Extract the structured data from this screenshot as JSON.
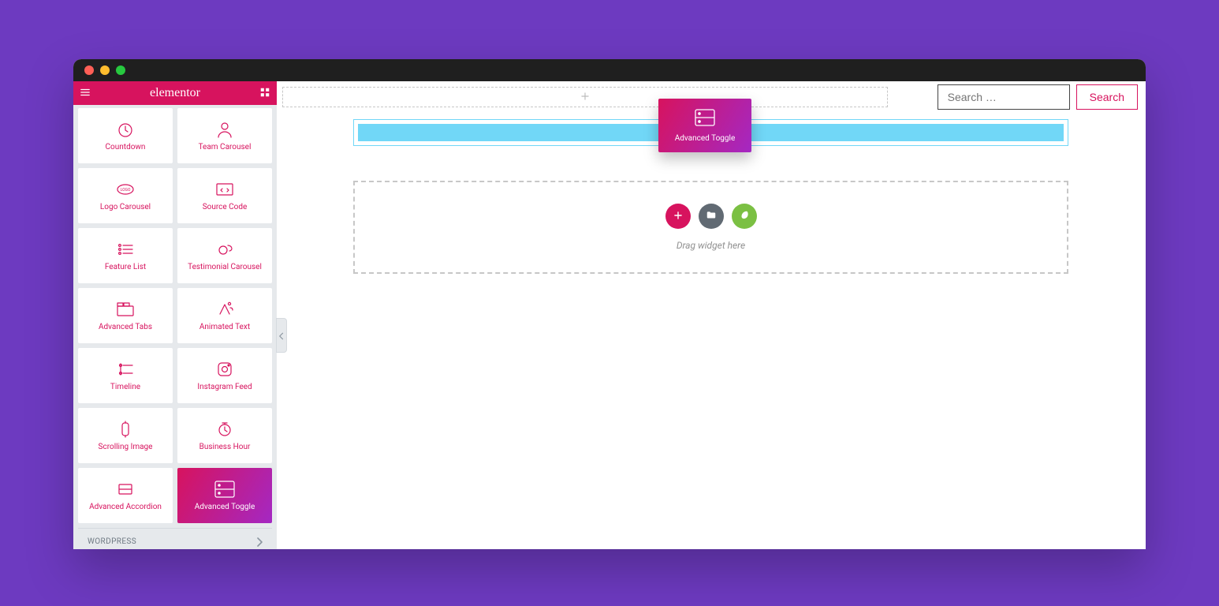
{
  "brand": "elementor",
  "category_label": "WORDPRESS",
  "search": {
    "placeholder": "Search …",
    "button": "Search"
  },
  "drag_hint": "Drag widget here",
  "drag_preview_label": "Advanced Toggle",
  "widgets": [
    {
      "label": "Countdown",
      "icon": "countdown"
    },
    {
      "label": "Team Carousel",
      "icon": "team"
    },
    {
      "label": "Logo Carousel",
      "icon": "logo"
    },
    {
      "label": "Source Code",
      "icon": "code"
    },
    {
      "label": "Feature List",
      "icon": "list"
    },
    {
      "label": "Testimonial Carousel",
      "icon": "testimonial"
    },
    {
      "label": "Advanced Tabs",
      "icon": "tabs"
    },
    {
      "label": "Animated Text",
      "icon": "animtext"
    },
    {
      "label": "Timeline",
      "icon": "timeline"
    },
    {
      "label": "Instagram Feed",
      "icon": "instagram"
    },
    {
      "label": "Scrolling Image",
      "icon": "scrollimg"
    },
    {
      "label": "Business Hour",
      "icon": "clock"
    },
    {
      "label": "Advanced Accordion",
      "icon": "accordion"
    },
    {
      "label": "Advanced Toggle",
      "icon": "toggle",
      "active": true
    }
  ]
}
